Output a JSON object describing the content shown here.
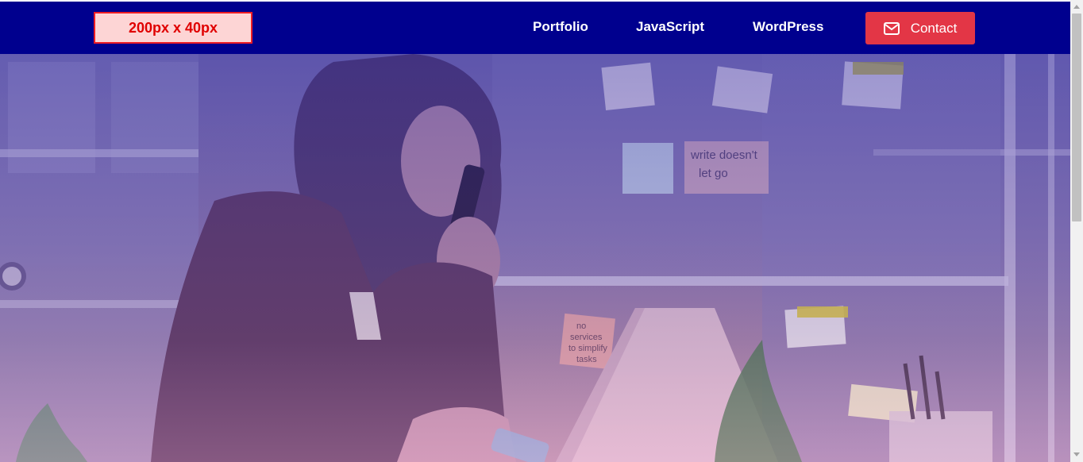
{
  "header": {
    "logo_placeholder": "200px x 40px",
    "nav": [
      {
        "label": "Portfolio"
      },
      {
        "label": "JavaScript"
      },
      {
        "label": "WordPress"
      }
    ],
    "contact": {
      "label": "Contact",
      "icon": "envelope-icon"
    }
  },
  "hero": {
    "image_subject": "woman on phone at office desk with sticky notes",
    "sticky_notes": [
      "write doesn't let go",
      "no services to simplify tasks"
    ]
  },
  "colors": {
    "navbar": "#00008e",
    "contact_button": "#e33646",
    "logo_border": "#ee1d24",
    "logo_fill": "#fdd5d5",
    "logo_text": "#e00000"
  }
}
